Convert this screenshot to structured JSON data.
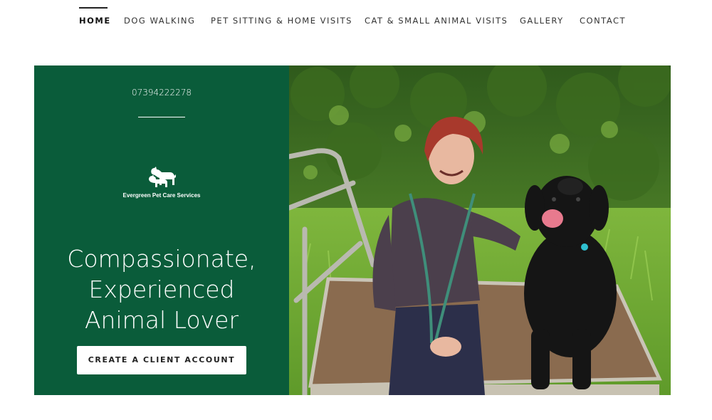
{
  "nav": {
    "items": [
      {
        "label": "HOME",
        "active": true
      },
      {
        "label": "DOG WALKING"
      },
      {
        "label": "PET SITTING & HOME VISITS"
      },
      {
        "label": "CAT & SMALL ANIMAL VISITS"
      },
      {
        "label": "GALLERY"
      },
      {
        "label": "CONTACT"
      }
    ]
  },
  "hero": {
    "phone": "07394222278",
    "logo_text": "Evergreen Pet Care Services",
    "headline_lines": [
      "Compassionate,",
      "Experienced",
      "Animal Lover"
    ],
    "cta_label": "CREATE A CLIENT ACCOUNT",
    "panel_color": "#0a5c3a"
  },
  "photo": {
    "icon": "woman-with-black-labrador-photo"
  }
}
